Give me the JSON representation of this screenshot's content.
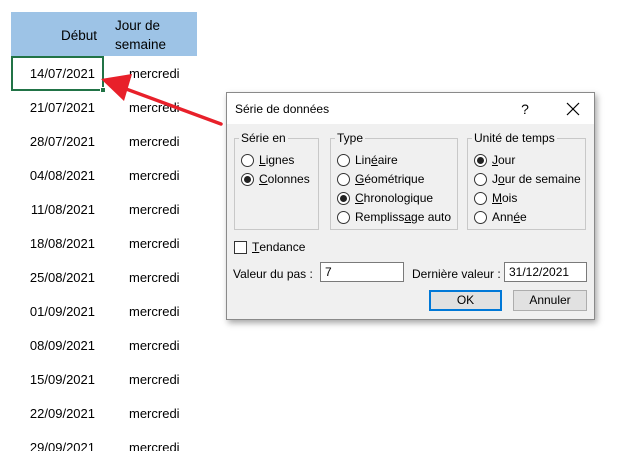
{
  "sheet": {
    "col_debut": "Début",
    "col_jour": "Jour de semaine",
    "rows": [
      {
        "date": "14/07/2021",
        "day": "mercredi"
      },
      {
        "date": "21/07/2021",
        "day": "mercredi"
      },
      {
        "date": "28/07/2021",
        "day": "mercredi"
      },
      {
        "date": "04/08/2021",
        "day": "mercredi"
      },
      {
        "date": "11/08/2021",
        "day": "mercredi"
      },
      {
        "date": "18/08/2021",
        "day": "mercredi"
      },
      {
        "date": "25/08/2021",
        "day": "mercredi"
      },
      {
        "date": "01/09/2021",
        "day": "mercredi"
      },
      {
        "date": "08/09/2021",
        "day": "mercredi"
      },
      {
        "date": "15/09/2021",
        "day": "mercredi"
      },
      {
        "date": "22/09/2021",
        "day": "mercredi"
      },
      {
        "date": "29/09/2021",
        "day": "mercredi"
      }
    ],
    "header_color": "#9dc3e6",
    "selection_color": "#217346"
  },
  "annotation": {
    "arrow_color": "#e8202a",
    "arrow_icon": "red-arrow-icon"
  },
  "dialog": {
    "title": "Série de données",
    "help": "?",
    "serie_en": {
      "label": "Série en",
      "lignes": {
        "ul": "L",
        "rest": "ignes"
      },
      "colonnes": {
        "ul": "C",
        "rest": "olonnes"
      }
    },
    "type": {
      "label": "Type",
      "lineaire": {
        "pre": "Lin",
        "ul": "é",
        "rest": "aire"
      },
      "geometrique": {
        "ul": "G",
        "rest": "éométrique"
      },
      "chronologique": {
        "ul": "C",
        "rest": "hronologique"
      },
      "remplissage": {
        "pre": "Rempliss",
        "ul": "a",
        "rest": "ge auto"
      }
    },
    "unite": {
      "label": "Unité de temps",
      "jour": {
        "ul": "J",
        "rest": "our"
      },
      "jour_semaine": {
        "pre": "J",
        "ul": "o",
        "rest": "ur de semaine"
      },
      "mois": {
        "ul": "M",
        "rest": "ois"
      },
      "annee": {
        "pre": "Ann",
        "ul": "é",
        "rest": "e"
      }
    },
    "tendance": {
      "ul": "T",
      "rest": "endance"
    },
    "valeur_pas_label": "Valeur du pas :",
    "valeur_pas_value": "7",
    "derniere_label": "Dernière valeur :",
    "derniere_value": "31/12/2021",
    "ok_label": "OK",
    "annuler_label": "Annuler",
    "accent_color": "#0078d7"
  }
}
